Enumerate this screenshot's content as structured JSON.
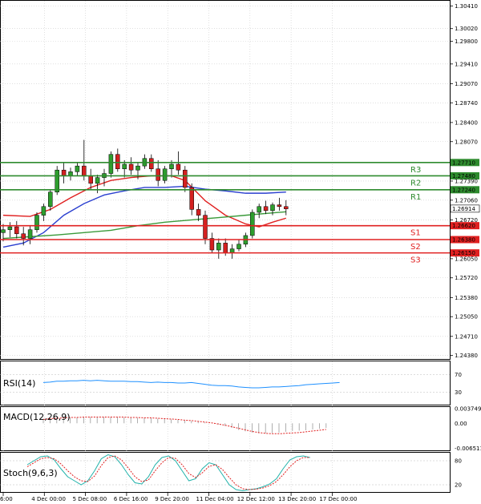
{
  "chart_data": {
    "type": "candlestick",
    "instrument_price_axis": {
      "ticks": [
        "1.30410",
        "1.30020",
        "1.29800",
        "1.29410",
        "1.29070",
        "1.28740",
        "1.28400",
        "1.28070",
        "1.27390",
        "1.27060",
        "1.26720",
        "1.26050",
        "1.25720",
        "1.25380",
        "1.25050",
        "1.24710",
        "1.24380"
      ],
      "ylim": [
        1.2432,
        1.305
      ]
    },
    "x_ticks": [
      "6:00",
      "4 Dec 00:00",
      "5 Dec 08:00",
      "6 Dec 16:00",
      "9 Dec 20:00",
      "11 Dec 04:00",
      "12 Dec 12:00",
      "13 Dec 20:00",
      "17 Dec 00:00"
    ],
    "candles": [
      [
        1.265,
        1.2665,
        1.2635,
        1.2655
      ],
      [
        1.2655,
        1.2668,
        1.2642,
        1.266
      ],
      [
        1.266,
        1.267,
        1.264,
        1.2648
      ],
      [
        1.2648,
        1.266,
        1.2628,
        1.264
      ],
      [
        1.264,
        1.2662,
        1.263,
        1.2655
      ],
      [
        1.2655,
        1.2685,
        1.265,
        1.268
      ],
      [
        1.268,
        1.27,
        1.267,
        1.2695
      ],
      [
        1.2695,
        1.2725,
        1.2688,
        1.272
      ],
      [
        1.272,
        1.2765,
        1.2715,
        1.2758
      ],
      [
        1.2758,
        1.277,
        1.2735,
        1.2748
      ],
      [
        1.2748,
        1.2762,
        1.274,
        1.2755
      ],
      [
        1.2755,
        1.277,
        1.2748,
        1.2765
      ],
      [
        1.2765,
        1.281,
        1.274,
        1.2748
      ],
      [
        1.2748,
        1.276,
        1.2725,
        1.2735
      ],
      [
        1.2735,
        1.275,
        1.2718,
        1.2745
      ],
      [
        1.2745,
        1.276,
        1.273,
        1.2752
      ],
      [
        1.2752,
        1.279,
        1.2745,
        1.2785
      ],
      [
        1.2785,
        1.2795,
        1.2755,
        1.276
      ],
      [
        1.276,
        1.2775,
        1.2745,
        1.2768
      ],
      [
        1.2768,
        1.278,
        1.275,
        1.2758
      ],
      [
        1.2758,
        1.277,
        1.2742,
        1.2765
      ],
      [
        1.2765,
        1.2785,
        1.276,
        1.2778
      ],
      [
        1.2778,
        1.2785,
        1.2755,
        1.276
      ],
      [
        1.276,
        1.2775,
        1.273,
        1.274
      ],
      [
        1.274,
        1.2765,
        1.2735,
        1.276
      ],
      [
        1.276,
        1.2775,
        1.2745,
        1.2768
      ],
      [
        1.2768,
        1.279,
        1.275,
        1.2758
      ],
      [
        1.2758,
        1.2765,
        1.272,
        1.2728
      ],
      [
        1.2728,
        1.2735,
        1.268,
        1.269
      ],
      [
        1.269,
        1.27,
        1.267,
        1.268
      ],
      [
        1.268,
        1.2688,
        1.263,
        1.264
      ],
      [
        1.264,
        1.265,
        1.2615,
        1.262
      ],
      [
        1.262,
        1.264,
        1.2605,
        1.2632
      ],
      [
        1.2632,
        1.264,
        1.261,
        1.2615
      ],
      [
        1.2615,
        1.263,
        1.2605,
        1.2622
      ],
      [
        1.2622,
        1.2638,
        1.2618,
        1.263
      ],
      [
        1.263,
        1.265,
        1.2625,
        1.2645
      ],
      [
        1.2645,
        1.269,
        1.264,
        1.2685
      ],
      [
        1.2685,
        1.27,
        1.2675,
        1.2695
      ],
      [
        1.2695,
        1.2705,
        1.2682,
        1.2688
      ],
      [
        1.2688,
        1.2702,
        1.268,
        1.2698
      ],
      [
        1.2698,
        1.271,
        1.2688,
        1.2695
      ],
      [
        1.2695,
        1.2706,
        1.268,
        1.2691
      ]
    ],
    "last_price": "1.26914",
    "levels": [
      {
        "name": "R3",
        "value": 1.2771,
        "tag": "1.27710",
        "color": "#2e8b2e"
      },
      {
        "name": "R2",
        "value": 1.2748,
        "tag": "1.27480",
        "color": "#2e8b2e"
      },
      {
        "name": "R1",
        "value": 1.2724,
        "tag": "1.27240",
        "color": "#2e8b2e"
      },
      {
        "name": "S1",
        "value": 1.2662,
        "tag": "1.26620",
        "color": "#e02020"
      },
      {
        "name": "S2",
        "value": 1.2638,
        "tag": "1.26380",
        "color": "#e02020"
      },
      {
        "name": "S3",
        "value": 1.2615,
        "tag": "1.26150",
        "color": "#e02020"
      }
    ],
    "moving_averages": [
      {
        "color": "#e02020",
        "points": [
          [
            0,
            1.268
          ],
          [
            4,
            1.2678
          ],
          [
            7,
            1.269
          ],
          [
            10,
            1.271
          ],
          [
            13,
            1.2728
          ],
          [
            16,
            1.274
          ],
          [
            19,
            1.2745
          ],
          [
            22,
            1.2748
          ],
          [
            25,
            1.2748
          ],
          [
            27,
            1.274
          ],
          [
            30,
            1.2705
          ],
          [
            33,
            1.268
          ],
          [
            36,
            1.2665
          ],
          [
            38,
            1.266
          ],
          [
            40,
            1.2668
          ],
          [
            42,
            1.2675
          ]
        ]
      },
      {
        "color": "#2a3fcf",
        "points": [
          [
            0,
            1.2625
          ],
          [
            3,
            1.2632
          ],
          [
            6,
            1.265
          ],
          [
            9,
            1.268
          ],
          [
            12,
            1.27
          ],
          [
            15,
            1.2715
          ],
          [
            18,
            1.2722
          ],
          [
            21,
            1.2728
          ],
          [
            24,
            1.2728
          ],
          [
            27,
            1.273
          ],
          [
            30,
            1.2725
          ],
          [
            33,
            1.2722
          ],
          [
            36,
            1.2718
          ],
          [
            39,
            1.2718
          ],
          [
            42,
            1.272
          ]
        ]
      },
      {
        "color": "#3a9a3a",
        "points": [
          [
            0,
            1.264
          ],
          [
            4,
            1.2643
          ],
          [
            8,
            1.2646
          ],
          [
            12,
            1.265
          ],
          [
            16,
            1.2654
          ],
          [
            20,
            1.2662
          ],
          [
            24,
            1.2668
          ],
          [
            28,
            1.2672
          ],
          [
            32,
            1.2676
          ],
          [
            36,
            1.268
          ],
          [
            40,
            1.2684
          ],
          [
            42,
            1.2686
          ]
        ]
      }
    ],
    "rsi": {
      "label": "RSI(14)",
      "ticks": [
        "70",
        "30"
      ],
      "ylim": [
        0,
        100
      ],
      "values": [
        52,
        53,
        55,
        55,
        56,
        56,
        57,
        56,
        57,
        56,
        55,
        55,
        55,
        54,
        54,
        53,
        52,
        53,
        52,
        52,
        51,
        51,
        52,
        50,
        48,
        46,
        45,
        45,
        44,
        42,
        41,
        40,
        40,
        41,
        42,
        42,
        43,
        44,
        45,
        47,
        48,
        49,
        50,
        51,
        52
      ]
    },
    "macd": {
      "label": "MACD(12,26,9)",
      "ticks": [
        "0.003749",
        "0.00",
        "-0.006511"
      ],
      "ylim": [
        -0.0072,
        0.0042
      ],
      "histogram": [
        0.0012,
        0.0013,
        0.0014,
        0.0014,
        0.0015,
        0.0015,
        0.0015,
        0.0016,
        0.0016,
        0.0016,
        0.0016,
        0.0016,
        0.0015,
        0.0015,
        0.0014,
        0.0014,
        0.0013,
        0.0012,
        0.0011,
        0.001,
        0.0009,
        0.0007,
        0.0006,
        0.0004,
        0.0002,
        0.0,
        -0.0003,
        -0.0007,
        -0.0012,
        -0.0017,
        -0.0021,
        -0.0024,
        -0.0026,
        -0.0026,
        -0.0025,
        -0.0024,
        -0.0022,
        -0.002,
        -0.0019,
        -0.0018,
        -0.0016,
        -0.0014,
        -0.0012
      ],
      "signal": [
        0.001,
        0.0012,
        0.0013,
        0.0014,
        0.0015,
        0.0015,
        0.0016,
        0.0016,
        0.0016,
        0.0016,
        0.0016,
        0.0016,
        0.0016,
        0.0015,
        0.0015,
        0.0014,
        0.0014,
        0.0013,
        0.0012,
        0.0011,
        0.001,
        0.0008,
        0.0007,
        0.0005,
        0.0003,
        0.0001,
        -0.0002,
        -0.0005,
        -0.0009,
        -0.0013,
        -0.0017,
        -0.0021,
        -0.0024,
        -0.0026,
        -0.0027,
        -0.0027,
        -0.0026,
        -0.0025,
        -0.0024,
        -0.0022,
        -0.002,
        -0.0018,
        -0.0016
      ]
    },
    "stoch": {
      "label": "Stoch(9,6,3)",
      "ticks": [
        "80",
        "20"
      ],
      "ylim": [
        0,
        100
      ],
      "k": [
        70,
        80,
        90,
        92,
        82,
        60,
        40,
        30,
        20,
        30,
        55,
        85,
        95,
        90,
        70,
        45,
        25,
        22,
        40,
        70,
        88,
        92,
        80,
        55,
        30,
        35,
        60,
        75,
        70,
        45,
        20,
        8,
        5,
        8,
        10,
        15,
        22,
        35,
        60,
        82,
        90,
        92,
        88
      ],
      "d": [
        65,
        75,
        85,
        88,
        85,
        72,
        55,
        40,
        30,
        28,
        42,
        68,
        88,
        92,
        82,
        62,
        40,
        28,
        32,
        55,
        75,
        88,
        86,
        70,
        48,
        38,
        50,
        66,
        70,
        58,
        38,
        20,
        10,
        8,
        9,
        12,
        18,
        28,
        45,
        65,
        80,
        88,
        88
      ]
    }
  }
}
